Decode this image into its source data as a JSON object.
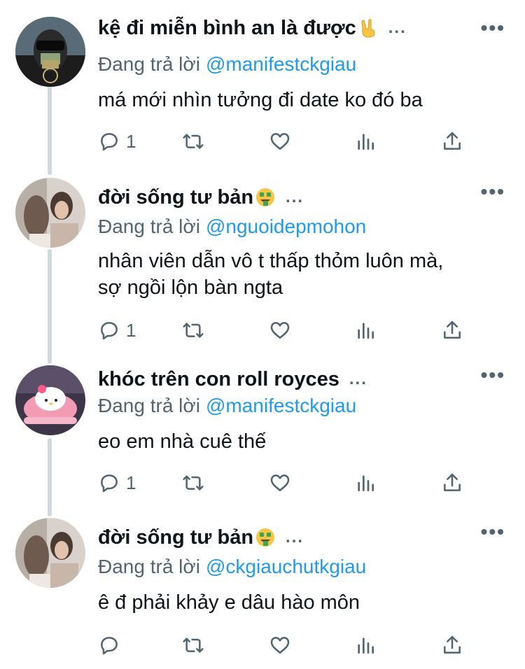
{
  "tweets": [
    {
      "name": "kệ đi miễn bình an là được",
      "name_emoji": "victory-hand",
      "name_suffix": "...",
      "reply_prefix": "Đang trả lời",
      "reply_handle": "@manifestckgiau",
      "lines": [
        "má mới nhìn tưởng đi date ko đó ba"
      ],
      "reply_count": "1"
    },
    {
      "name": "đời sống tư bản",
      "name_emoji": "money-mouth-face",
      "name_suffix": "...",
      "reply_prefix": "Đang trả lời",
      "reply_handle": "@nguoidepmohon",
      "lines": [
        "nhân viên dẫn vô t thấp thỏm luôn mà,",
        "sợ ngồi lộn bàn ngta"
      ],
      "reply_count": "1"
    },
    {
      "name": "khóc trên con roll royces",
      "name_emoji": "",
      "name_suffix": "...",
      "reply_prefix": "Đang trả lời",
      "reply_handle": "@manifestckgiau",
      "lines": [
        "eo em nhà cuê thế"
      ],
      "reply_count": "1"
    },
    {
      "name": "đời sống tư bản",
      "name_emoji": "money-mouth-face",
      "name_suffix": "...",
      "reply_prefix": "Đang trả lời",
      "reply_handle": "@ckgiauchutkgiau",
      "lines": [
        "ê đ phải khảy e dâu hào môn"
      ],
      "reply_count": ""
    }
  ],
  "more_menu": "•••",
  "icons": [
    "reply-icon",
    "retweet-icon",
    "like-icon",
    "views-icon",
    "share-icon"
  ],
  "colors": {
    "link": "#1d9bf0",
    "secondary": "#536471",
    "text": "#0f1419",
    "thread_line": "#cfd9de"
  }
}
